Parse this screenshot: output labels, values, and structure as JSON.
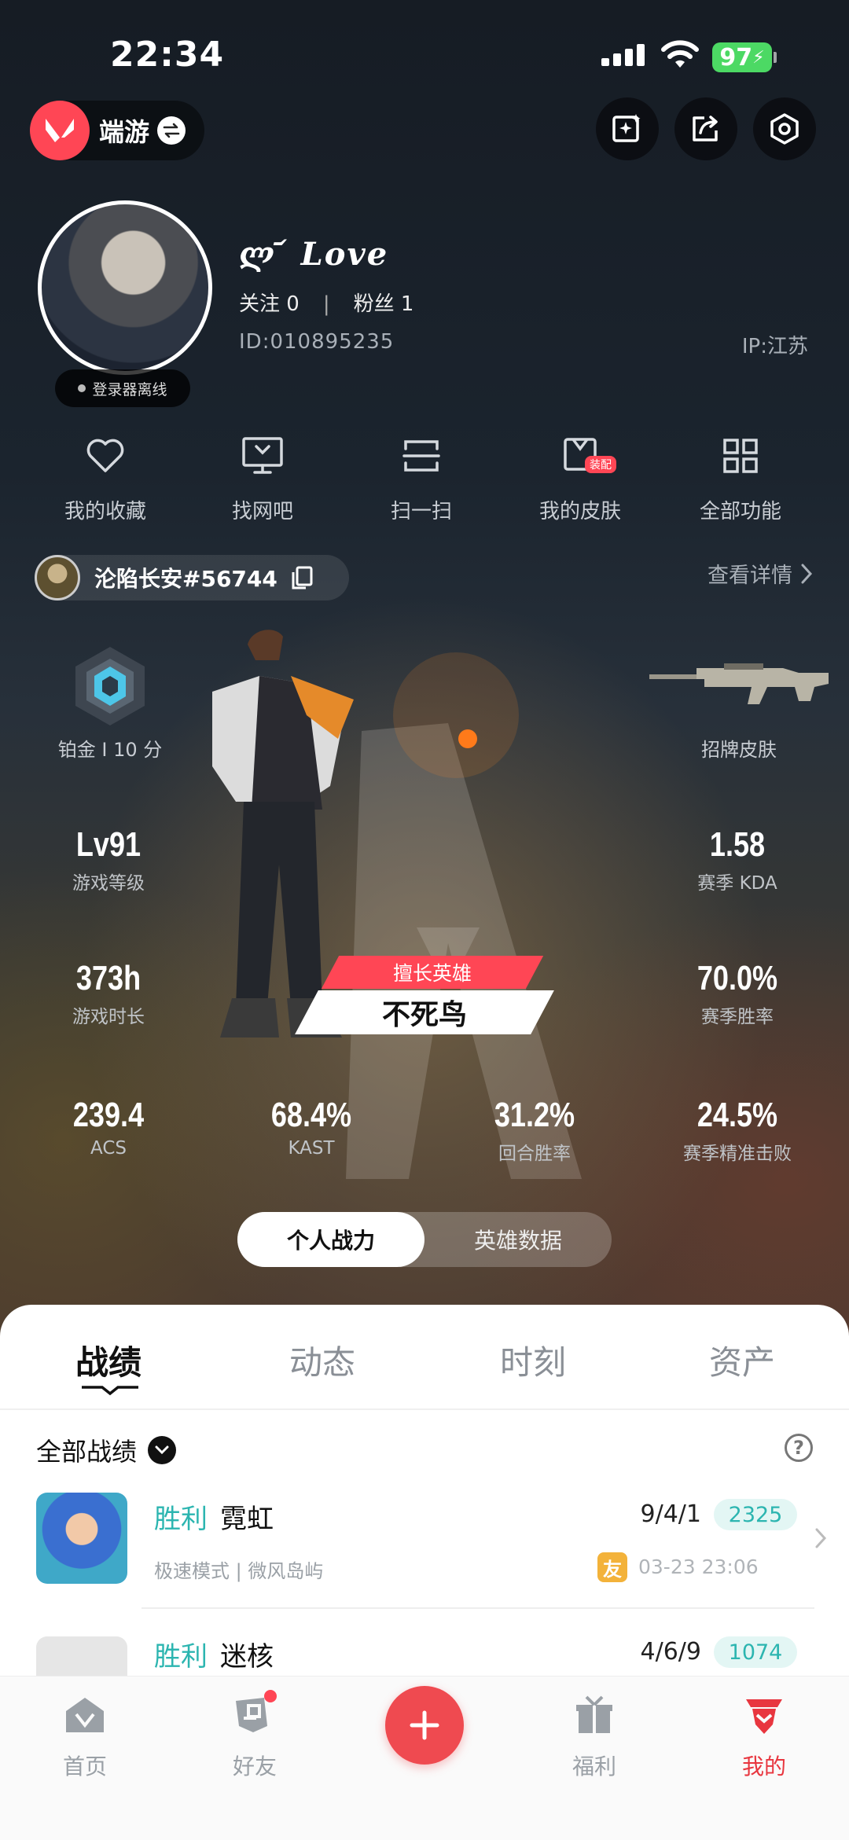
{
  "status_bar": {
    "time": "22:34",
    "battery": "97"
  },
  "top_bar": {
    "mode_label": "端游"
  },
  "profile": {
    "nickname": "ლ ᷄ Love",
    "follow_label": "关注 0",
    "fans_label": "粉丝 1",
    "separator": "|",
    "id": "ID:010895235",
    "ip": "IP:江苏",
    "status": "登录器离线"
  },
  "functions": [
    {
      "label": "我的收藏",
      "icon": "heart-icon"
    },
    {
      "label": "找网吧",
      "icon": "monitor-icon"
    },
    {
      "label": "扫一扫",
      "icon": "scan-icon"
    },
    {
      "label": "我的皮肤",
      "icon": "skin-icon",
      "badge": "装配"
    },
    {
      "label": "全部功能",
      "icon": "grid-icon"
    }
  ],
  "account": {
    "name": "沦陷长安#56744",
    "detail_label": "查看详情"
  },
  "rank": {
    "label": "铂金 I 10 分"
  },
  "weapon": {
    "label": "招牌皮肤"
  },
  "stats": {
    "level": {
      "value": "Lv91",
      "label": "游戏等级"
    },
    "kda": {
      "value": "1.58",
      "label": "赛季 KDA"
    },
    "hours": {
      "value": "373h",
      "label": "游戏时长"
    },
    "winrate": {
      "value": "70.0%",
      "label": "赛季胜率"
    },
    "acs": {
      "value": "239.4",
      "label": "ACS"
    },
    "kast": {
      "value": "68.4%",
      "label": "KAST"
    },
    "round_winrate": {
      "value": "31.2%",
      "label": "回合胜率"
    },
    "headshot": {
      "value": "24.5%",
      "label": "赛季精准击败"
    }
  },
  "hero": {
    "tag": "擅长英雄",
    "name": "不死鸟"
  },
  "segment": {
    "on": "个人战力",
    "off": "英雄数据"
  },
  "tabs": [
    "战绩",
    "动态",
    "时刻",
    "资产"
  ],
  "filter": {
    "label": "全部战绩",
    "help": "?"
  },
  "matches": [
    {
      "result": "胜利",
      "map": "霓虹",
      "kda": "9/4/1",
      "score": "2325",
      "mode": "极速模式 | 微风岛屿",
      "friend": "友",
      "time": "03-23 23:06"
    },
    {
      "result": "胜利",
      "map": "迷核",
      "kda": "4/6/9",
      "score": "1074"
    }
  ],
  "nav": [
    {
      "label": "首页",
      "icon": "home-icon"
    },
    {
      "label": "好友",
      "icon": "friends-icon"
    },
    {
      "label": "福利",
      "icon": "gift-icon"
    },
    {
      "label": "我的",
      "icon": "profile-icon"
    }
  ],
  "colors": {
    "accent": "#ff4655",
    "win": "#2cb5b0",
    "nav_active": "#e8363f"
  }
}
